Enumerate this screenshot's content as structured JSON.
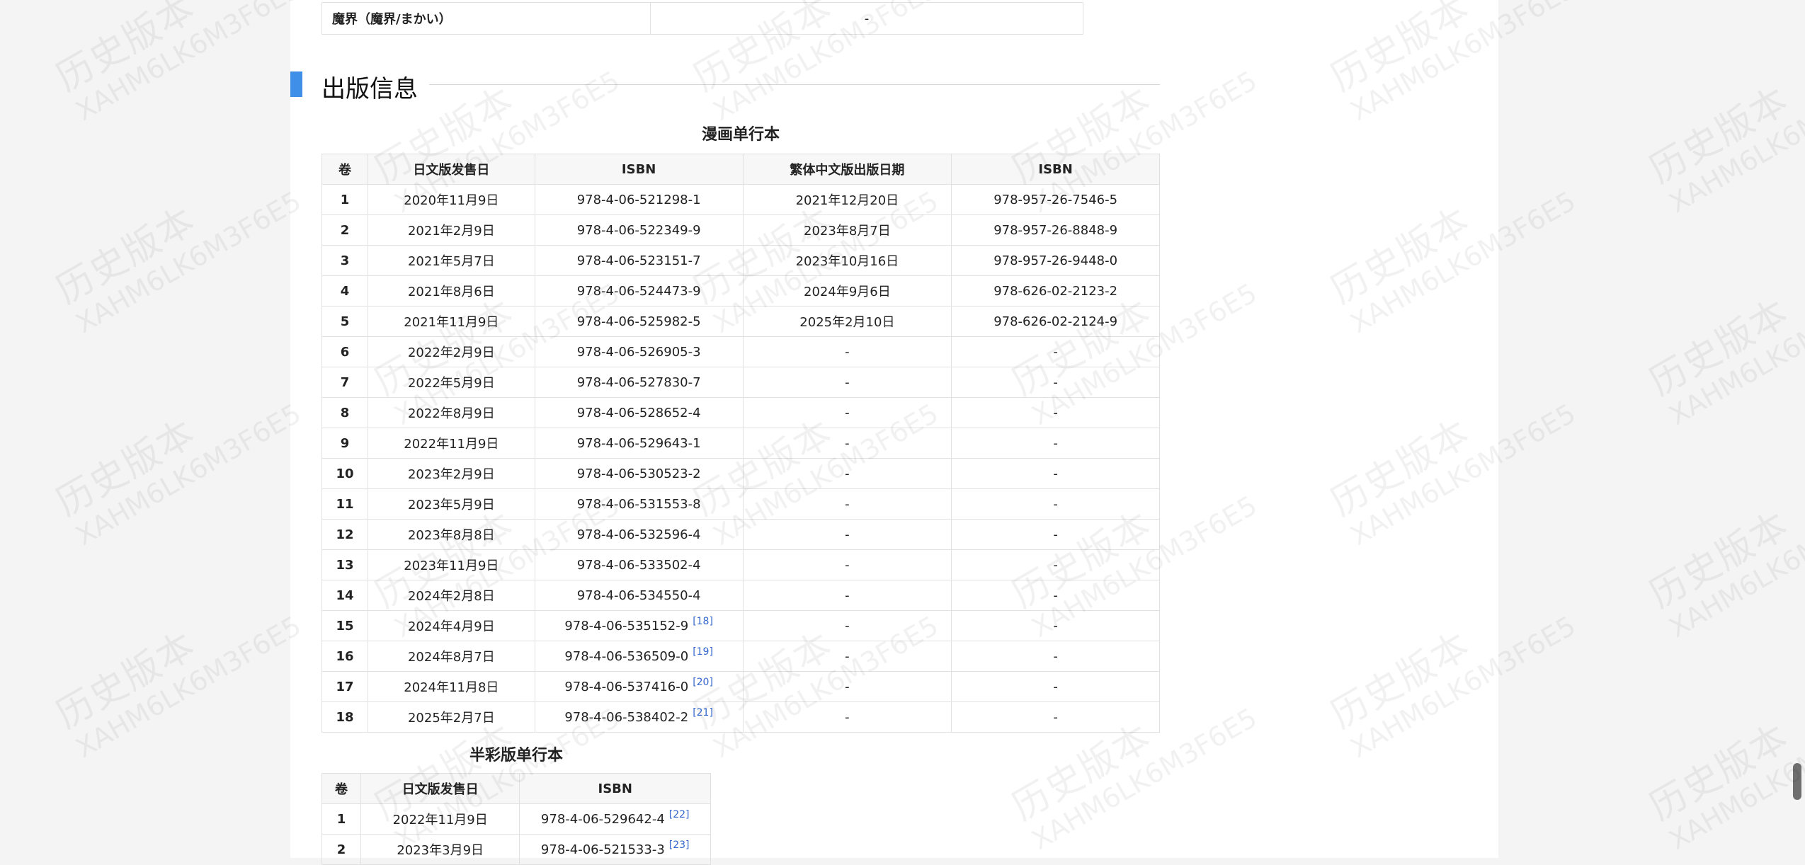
{
  "top_row": {
    "label": "魔界（魔界/まかい）",
    "value": "-"
  },
  "section": {
    "title": "出版信息"
  },
  "manga_volumes": {
    "caption": "漫画单行本",
    "headers": [
      "卷",
      "日文版发售日",
      "ISBN",
      "繁体中文版出版日期",
      "ISBN"
    ],
    "rows": [
      {
        "vol": "1",
        "jp_date": "2020年11月9日",
        "jp_isbn": "978-4-06-521298-1",
        "ref": "",
        "tw_date": "2021年12月20日",
        "tw_isbn": "978-957-26-7546-5"
      },
      {
        "vol": "2",
        "jp_date": "2021年2月9日",
        "jp_isbn": "978-4-06-522349-9",
        "ref": "",
        "tw_date": "2023年8月7日",
        "tw_isbn": "978-957-26-8848-9"
      },
      {
        "vol": "3",
        "jp_date": "2021年5月7日",
        "jp_isbn": "978-4-06-523151-7",
        "ref": "",
        "tw_date": "2023年10月16日",
        "tw_isbn": "978-957-26-9448-0"
      },
      {
        "vol": "4",
        "jp_date": "2021年8月6日",
        "jp_isbn": "978-4-06-524473-9",
        "ref": "",
        "tw_date": "2024年9月6日",
        "tw_isbn": "978-626-02-2123-2"
      },
      {
        "vol": "5",
        "jp_date": "2021年11月9日",
        "jp_isbn": "978-4-06-525982-5",
        "ref": "",
        "tw_date": "2025年2月10日",
        "tw_isbn": "978-626-02-2124-9"
      },
      {
        "vol": "6",
        "jp_date": "2022年2月9日",
        "jp_isbn": "978-4-06-526905-3",
        "ref": "",
        "tw_date": "-",
        "tw_isbn": "-"
      },
      {
        "vol": "7",
        "jp_date": "2022年5月9日",
        "jp_isbn": "978-4-06-527830-7",
        "ref": "",
        "tw_date": "-",
        "tw_isbn": "-"
      },
      {
        "vol": "8",
        "jp_date": "2022年8月9日",
        "jp_isbn": "978-4-06-528652-4",
        "ref": "",
        "tw_date": "-",
        "tw_isbn": "-"
      },
      {
        "vol": "9",
        "jp_date": "2022年11月9日",
        "jp_isbn": "978-4-06-529643-1",
        "ref": "",
        "tw_date": "-",
        "tw_isbn": "-"
      },
      {
        "vol": "10",
        "jp_date": "2023年2月9日",
        "jp_isbn": "978-4-06-530523-2",
        "ref": "",
        "tw_date": "-",
        "tw_isbn": "-"
      },
      {
        "vol": "11",
        "jp_date": "2023年5月9日",
        "jp_isbn": "978-4-06-531553-8",
        "ref": "",
        "tw_date": "-",
        "tw_isbn": "-"
      },
      {
        "vol": "12",
        "jp_date": "2023年8月8日",
        "jp_isbn": "978-4-06-532596-4",
        "ref": "",
        "tw_date": "-",
        "tw_isbn": "-"
      },
      {
        "vol": "13",
        "jp_date": "2023年11月9日",
        "jp_isbn": "978-4-06-533502-4",
        "ref": "",
        "tw_date": "-",
        "tw_isbn": "-"
      },
      {
        "vol": "14",
        "jp_date": "2024年2月8日",
        "jp_isbn": "978-4-06-534550-4",
        "ref": "",
        "tw_date": "-",
        "tw_isbn": "-"
      },
      {
        "vol": "15",
        "jp_date": "2024年4月9日",
        "jp_isbn": "978-4-06-535152-9",
        "ref": "[18]",
        "tw_date": "-",
        "tw_isbn": "-"
      },
      {
        "vol": "16",
        "jp_date": "2024年8月7日",
        "jp_isbn": "978-4-06-536509-0",
        "ref": "[19]",
        "tw_date": "-",
        "tw_isbn": "-"
      },
      {
        "vol": "17",
        "jp_date": "2024年11月8日",
        "jp_isbn": "978-4-06-537416-0",
        "ref": "[20]",
        "tw_date": "-",
        "tw_isbn": "-"
      },
      {
        "vol": "18",
        "jp_date": "2025年2月7日",
        "jp_isbn": "978-4-06-538402-2",
        "ref": "[21]",
        "tw_date": "-",
        "tw_isbn": "-"
      }
    ]
  },
  "halfcolor_volumes": {
    "caption": "半彩版单行本",
    "headers": [
      "卷",
      "日文版发售日",
      "ISBN"
    ],
    "rows": [
      {
        "vol": "1",
        "jp_date": "2022年11月9日",
        "jp_isbn": "978-4-06-529642-4",
        "ref": "[22]"
      },
      {
        "vol": "2",
        "jp_date": "2023年3月9日",
        "jp_isbn": "978-4-06-521533-3",
        "ref": "[23]"
      }
    ]
  },
  "watermark": {
    "line1": "历史版本",
    "line2": "XAHM6LK6M3F6E5"
  }
}
